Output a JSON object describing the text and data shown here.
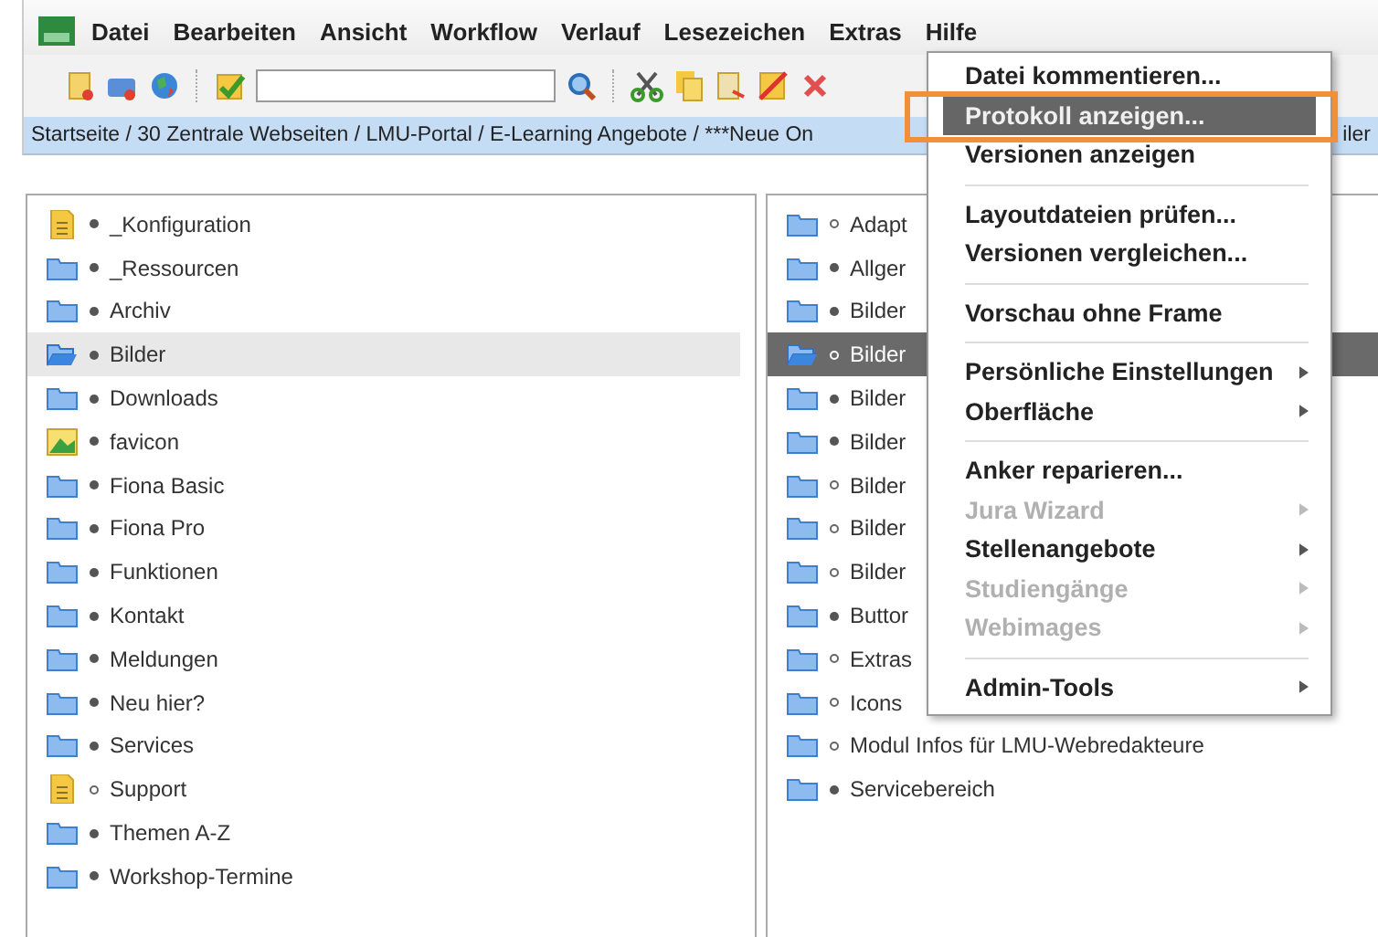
{
  "menubar": [
    {
      "label": "Datei"
    },
    {
      "label": "Bearbeiten"
    },
    {
      "label": "Ansicht"
    },
    {
      "label": "Workflow"
    },
    {
      "label": "Verlauf"
    },
    {
      "label": "Lesezeichen"
    },
    {
      "label": "Extras"
    },
    {
      "label": "Hilfe"
    }
  ],
  "breadcrumb": {
    "path": "Startseite / 30 Zentrale Webseiten / LMU-Portal / E-Learning Angebote / ***Neue On",
    "tail": "iler"
  },
  "left_tree": [
    {
      "label": "_Konfiguration",
      "kind": "document",
      "dot_filled": true,
      "selected": false
    },
    {
      "label": "_Ressourcen",
      "kind": "folder",
      "dot_filled": true,
      "selected": false
    },
    {
      "label": "Archiv",
      "kind": "folder",
      "dot_filled": true,
      "selected": false
    },
    {
      "label": "Bilder",
      "kind": "folder-open",
      "dot_filled": true,
      "selected": true
    },
    {
      "label": "Downloads",
      "kind": "folder",
      "dot_filled": true,
      "selected": false
    },
    {
      "label": "favicon",
      "kind": "image",
      "dot_filled": true,
      "selected": false
    },
    {
      "label": "Fiona Basic",
      "kind": "folder",
      "dot_filled": true,
      "selected": false
    },
    {
      "label": "Fiona Pro",
      "kind": "folder",
      "dot_filled": true,
      "selected": false
    },
    {
      "label": "Funktionen",
      "kind": "folder",
      "dot_filled": true,
      "selected": false
    },
    {
      "label": "Kontakt",
      "kind": "folder",
      "dot_filled": true,
      "selected": false
    },
    {
      "label": "Meldungen",
      "kind": "folder",
      "dot_filled": true,
      "selected": false
    },
    {
      "label": "Neu hier?",
      "kind": "folder",
      "dot_filled": true,
      "selected": false
    },
    {
      "label": "Services",
      "kind": "folder",
      "dot_filled": true,
      "selected": false
    },
    {
      "label": "Support",
      "kind": "document",
      "dot_filled": false,
      "selected": false
    },
    {
      "label": "Themen A-Z",
      "kind": "folder",
      "dot_filled": true,
      "selected": false
    },
    {
      "label": "Workshop-Termine",
      "kind": "folder",
      "dot_filled": true,
      "selected": false
    }
  ],
  "right_tree": [
    {
      "label": "Adapt",
      "kind": "folder",
      "dot_filled": false,
      "selected": false
    },
    {
      "label": "Allger",
      "kind": "folder",
      "dot_filled": true,
      "selected": false
    },
    {
      "label": "Bilder",
      "kind": "folder",
      "dot_filled": true,
      "selected": false
    },
    {
      "label": "Bilder",
      "kind": "folder-open",
      "dot_filled": false,
      "selected": true
    },
    {
      "label": "Bilder",
      "kind": "folder",
      "dot_filled": true,
      "selected": false
    },
    {
      "label": "Bilder",
      "kind": "folder",
      "dot_filled": true,
      "selected": false
    },
    {
      "label": "Bilder",
      "kind": "folder",
      "dot_filled": false,
      "selected": false
    },
    {
      "label": "Bilder",
      "kind": "folder",
      "dot_filled": false,
      "selected": false
    },
    {
      "label": "Bilder",
      "kind": "folder",
      "dot_filled": false,
      "selected": false
    },
    {
      "label": "Buttor",
      "kind": "folder",
      "dot_filled": true,
      "selected": false
    },
    {
      "label": "Extras",
      "kind": "folder",
      "dot_filled": false,
      "selected": false
    },
    {
      "label": "Icons",
      "kind": "folder",
      "dot_filled": false,
      "selected": false
    },
    {
      "label": "Modul Infos für LMU-Webredakteure",
      "kind": "folder",
      "dot_filled": false,
      "selected": false
    },
    {
      "label": "Servicebereich",
      "kind": "folder",
      "dot_filled": true,
      "selected": false
    }
  ],
  "extras_menu": [
    {
      "kind": "item",
      "label": "Datei kommentieren...",
      "selected": false,
      "disabled": false,
      "submenu": false
    },
    {
      "kind": "item",
      "label": "Protokoll anzeigen...",
      "selected": true,
      "disabled": false,
      "submenu": false
    },
    {
      "kind": "item",
      "label": "Versionen anzeigen",
      "selected": false,
      "disabled": false,
      "submenu": false
    },
    {
      "kind": "separator"
    },
    {
      "kind": "item",
      "label": "Layoutdateien prüfen...",
      "selected": false,
      "disabled": false,
      "submenu": false
    },
    {
      "kind": "item",
      "label": "Versionen vergleichen...",
      "selected": false,
      "disabled": false,
      "submenu": false
    },
    {
      "kind": "separator"
    },
    {
      "kind": "item",
      "label": "Vorschau ohne Frame",
      "selected": false,
      "disabled": false,
      "submenu": false
    },
    {
      "kind": "separator"
    },
    {
      "kind": "item",
      "label": "Persönliche Einstellungen",
      "selected": false,
      "disabled": false,
      "submenu": true
    },
    {
      "kind": "item",
      "label": "Oberfläche",
      "selected": false,
      "disabled": false,
      "submenu": true
    },
    {
      "kind": "separator"
    },
    {
      "kind": "item",
      "label": "Anker reparieren...",
      "selected": false,
      "disabled": false,
      "submenu": false
    },
    {
      "kind": "item",
      "label": "Jura Wizard",
      "selected": false,
      "disabled": true,
      "submenu": true
    },
    {
      "kind": "item",
      "label": "Stellenangebote",
      "selected": false,
      "disabled": false,
      "submenu": true
    },
    {
      "kind": "item",
      "label": "Studiengänge",
      "selected": false,
      "disabled": true,
      "submenu": true
    },
    {
      "kind": "item",
      "label": "Webimages",
      "selected": false,
      "disabled": true,
      "submenu": true
    },
    {
      "kind": "separator"
    },
    {
      "kind": "item",
      "label": "Admin-Tools",
      "selected": false,
      "disabled": false,
      "submenu": true
    }
  ]
}
